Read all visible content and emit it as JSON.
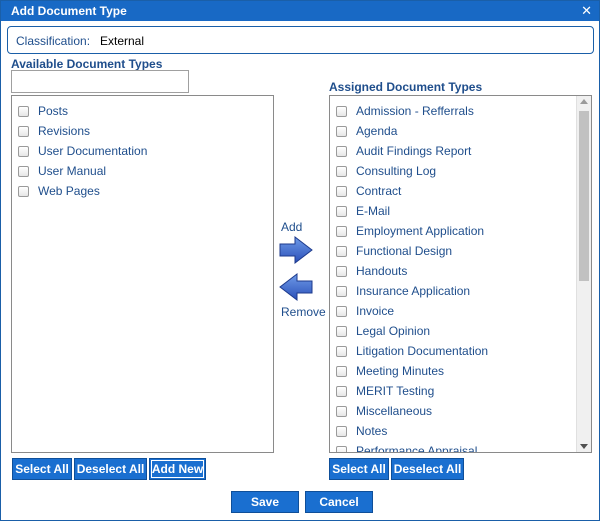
{
  "dialog": {
    "title": "Add Document Type"
  },
  "classification": {
    "label": "Classification:",
    "value": "External"
  },
  "available": {
    "heading": "Available Document Types",
    "search_value": "",
    "items": [
      "Posts",
      "Revisions",
      "User Documentation",
      "User Manual",
      "Web Pages"
    ]
  },
  "assigned": {
    "heading": "Assigned Document Types",
    "items": [
      "Admission - Refferrals",
      "Agenda",
      "Audit Findings Report",
      "Consulting Log",
      "Contract",
      "E-Mail",
      "Employment Application",
      "Functional Design",
      "Handouts",
      "Insurance Application",
      "Invoice",
      "Legal Opinion",
      "Litigation Documentation",
      "Meeting Minutes",
      "MERIT Testing",
      "Miscellaneous",
      "Notes",
      "Performance Appraisal"
    ]
  },
  "move": {
    "add_label": "Add",
    "remove_label": "Remove"
  },
  "buttons": {
    "select_all": "Select All",
    "deselect_all": "Deselect All",
    "add_new": "Add New",
    "save": "Save",
    "cancel": "Cancel"
  },
  "icons": {
    "close": "close-icon",
    "add": "arrow-right-icon",
    "remove": "arrow-left-icon"
  },
  "colors": {
    "accent": "#1869c5",
    "button": "#1a6fd0",
    "label_text": "#1f4e8c"
  }
}
